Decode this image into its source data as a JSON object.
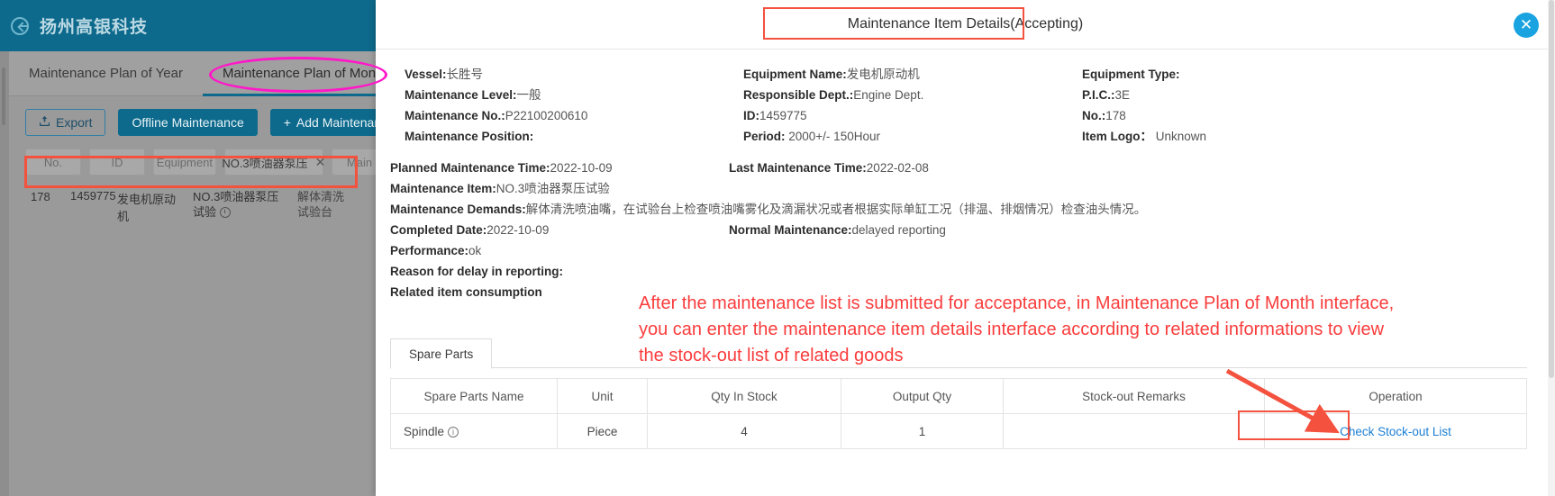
{
  "background_app": {
    "brand": "扬州高银科技",
    "back_icon": "back-arrow-circle-icon",
    "tabs": [
      {
        "label": "Maintenance Plan of Year",
        "active": false
      },
      {
        "label": "Maintenance Plan of Month",
        "active": true
      }
    ],
    "toolbar": {
      "export_label": "Export",
      "export_icon": "upload-icon",
      "offline_label": "Offline Maintenance",
      "add_label": "Add Maintenance Task",
      "add_icon": "plus-icon"
    },
    "filters": [
      {
        "label": "No.",
        "filled": false
      },
      {
        "label": "ID",
        "filled": false
      },
      {
        "label": "Equipment",
        "filled": false
      },
      {
        "label": "NO.3喷油器泵压",
        "filled": true,
        "clear_icon": "close-icon"
      },
      {
        "label": "Main",
        "filled": false
      }
    ],
    "row": {
      "no": "178",
      "id": "1459775",
      "equipment": "发电机原动机",
      "item": "NO.3喷油器泵压试验",
      "item_icon": "clock-icon",
      "demands": "解体清洗试验台"
    }
  },
  "annotations": {
    "title_highlight": "red-rectangle",
    "tab_ellipse": "magenta-ellipse",
    "filter_rectangle": "red-rectangle",
    "link_rectangle": "red-rectangle",
    "arrow": "red-arrow",
    "note_text": "After the maintenance list is submitted for acceptance, in Maintenance Plan of Month interface, you can enter the maintenance item details interface according to related informations to view the stock-out list of related goods",
    "note_color": "#fa3c3c"
  },
  "modal": {
    "title": "Maintenance Item Details(Accepting)",
    "close_icon": "close-circle-icon",
    "columns": {
      "left": [
        {
          "label": "Vessel:",
          "value": "长胜号"
        },
        {
          "label": "Maintenance Level:",
          "value": "一般"
        },
        {
          "label": "Maintenance No.:",
          "value": "P22100200610"
        },
        {
          "label": "Maintenance Position:",
          "value": ""
        }
      ],
      "middle": [
        {
          "label": "Equipment Name:",
          "value": "发电机原动机"
        },
        {
          "label": "Responsible Dept.:",
          "value": "Engine Dept."
        },
        {
          "label": "ID:",
          "value": "1459775"
        },
        {
          "label": "Period:",
          "value": " 2000+/- 150Hour"
        }
      ],
      "right": [
        {
          "label": "Equipment Type:",
          "value": ""
        },
        {
          "label": "P.I.C.:",
          "value": "3E"
        },
        {
          "label": "No.:",
          "value": "178"
        },
        {
          "label": "Item Logo：",
          "value": " Unknown"
        }
      ]
    },
    "rows": [
      {
        "label": "Planned Maintenance Time:",
        "value": "2022-10-09",
        "label2": "Last Maintenance Time:",
        "value2": "2022-02-08"
      },
      {
        "label": "Maintenance Item:",
        "value": "NO.3喷油器泵压试验",
        "label2": "",
        "value2": ""
      },
      {
        "label": "Maintenance Demands:",
        "value": "解体清洗喷油嘴，在试验台上检查喷油嘴雾化及滴漏状况或者根据实际单缸工况（排温、排烟情况）检查油头情况。",
        "label2": "",
        "value2": ""
      },
      {
        "label": "Completed Date:",
        "value": "2022-10-09",
        "label2": "Normal Maintenance:",
        "value2": "delayed reporting"
      },
      {
        "label": "Performance:",
        "value": "ok",
        "label2": "",
        "value2": ""
      },
      {
        "label": "Reason for delay in reporting:",
        "value": "",
        "label2": "",
        "value2": ""
      },
      {
        "label": "Related item consumption",
        "value": "",
        "label2": "",
        "value2": ""
      }
    ],
    "spare_parts_tab": "Spare Parts",
    "table": {
      "headers": [
        "Spare Parts Name",
        "Unit",
        "Qty In Stock",
        "Output Qty",
        "Stock-out Remarks",
        "Operation"
      ],
      "rows": [
        {
          "name": "Spindle",
          "name_icon": "info-icon",
          "unit": "Piece",
          "qty_in_stock": "4",
          "output_qty": "1",
          "remarks": "",
          "operation": "Check Stock-out List"
        }
      ]
    }
  }
}
